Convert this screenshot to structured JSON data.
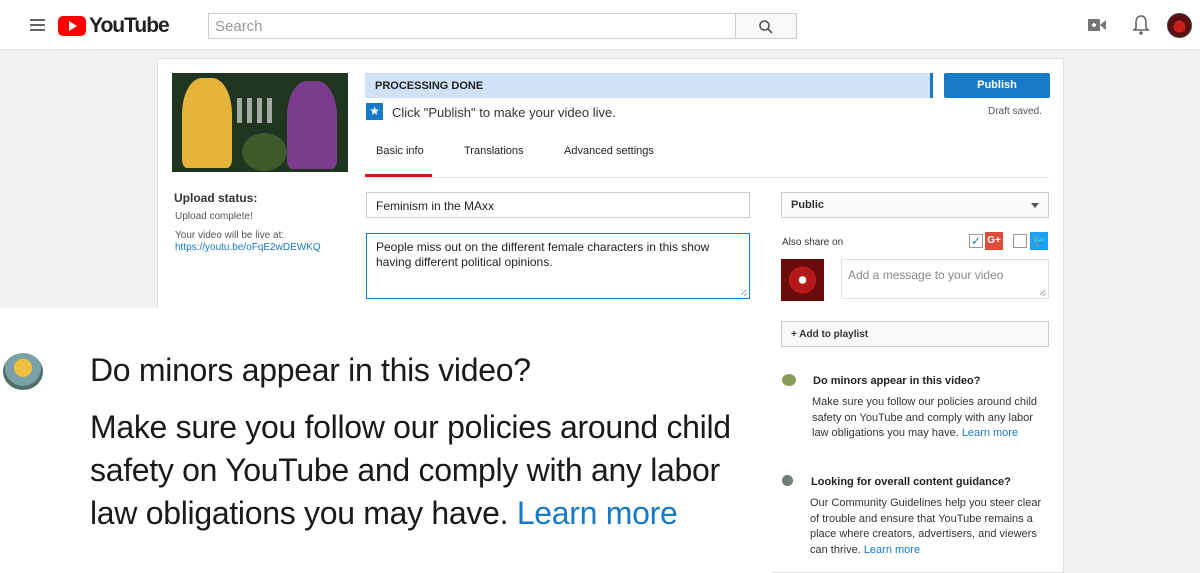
{
  "header": {
    "logo_text": "YouTube",
    "search_placeholder": "Search"
  },
  "upload": {
    "processing_status": "PROCESSING DONE",
    "publish_label": "Publish",
    "hint": "Click \"Publish\" to make your video live.",
    "draft_status": "Draft saved.",
    "tabs": [
      "Basic info",
      "Translations",
      "Advanced settings"
    ],
    "active_tab": "Basic info",
    "status_heading": "Upload status:",
    "status_text": "Upload complete!",
    "live_text": "Your video will be live at:",
    "video_link": "https://youtu.be/oFqE2wDEWKQ",
    "title": "Feminism in the MAxx",
    "description": "People miss out on the different female characters in this show having different political opinions.",
    "privacy": "Public",
    "share_label": "Also share on",
    "gplus_checked": true,
    "twitter_checked": false,
    "message_placeholder": "Add a message to your video",
    "playlist_label": "+ Add to playlist"
  },
  "sidebar": {
    "minors_title": "Do minors appear in this video?",
    "minors_text": "Make sure you follow our policies around child safety on YouTube and comply with any labor law obligations you may have.",
    "minors_link": "Learn more",
    "guidance_title": "Looking for overall content guidance?",
    "guidance_text": "Our Community Guidelines help you steer clear of trouble and ensure that YouTube remains a place where creators, advertisers, and viewers can thrive.",
    "guidance_link": "Learn more"
  },
  "zoom": {
    "title": "Do minors appear in this video?",
    "text": "Make sure you follow our policies around child safety on YouTube and comply with any labor law obligations you may have.",
    "link": "Learn more"
  },
  "colors": {
    "accent": "#167ac6",
    "processing_bg": "#cfe2f6",
    "brand_red": "#ff0000"
  }
}
